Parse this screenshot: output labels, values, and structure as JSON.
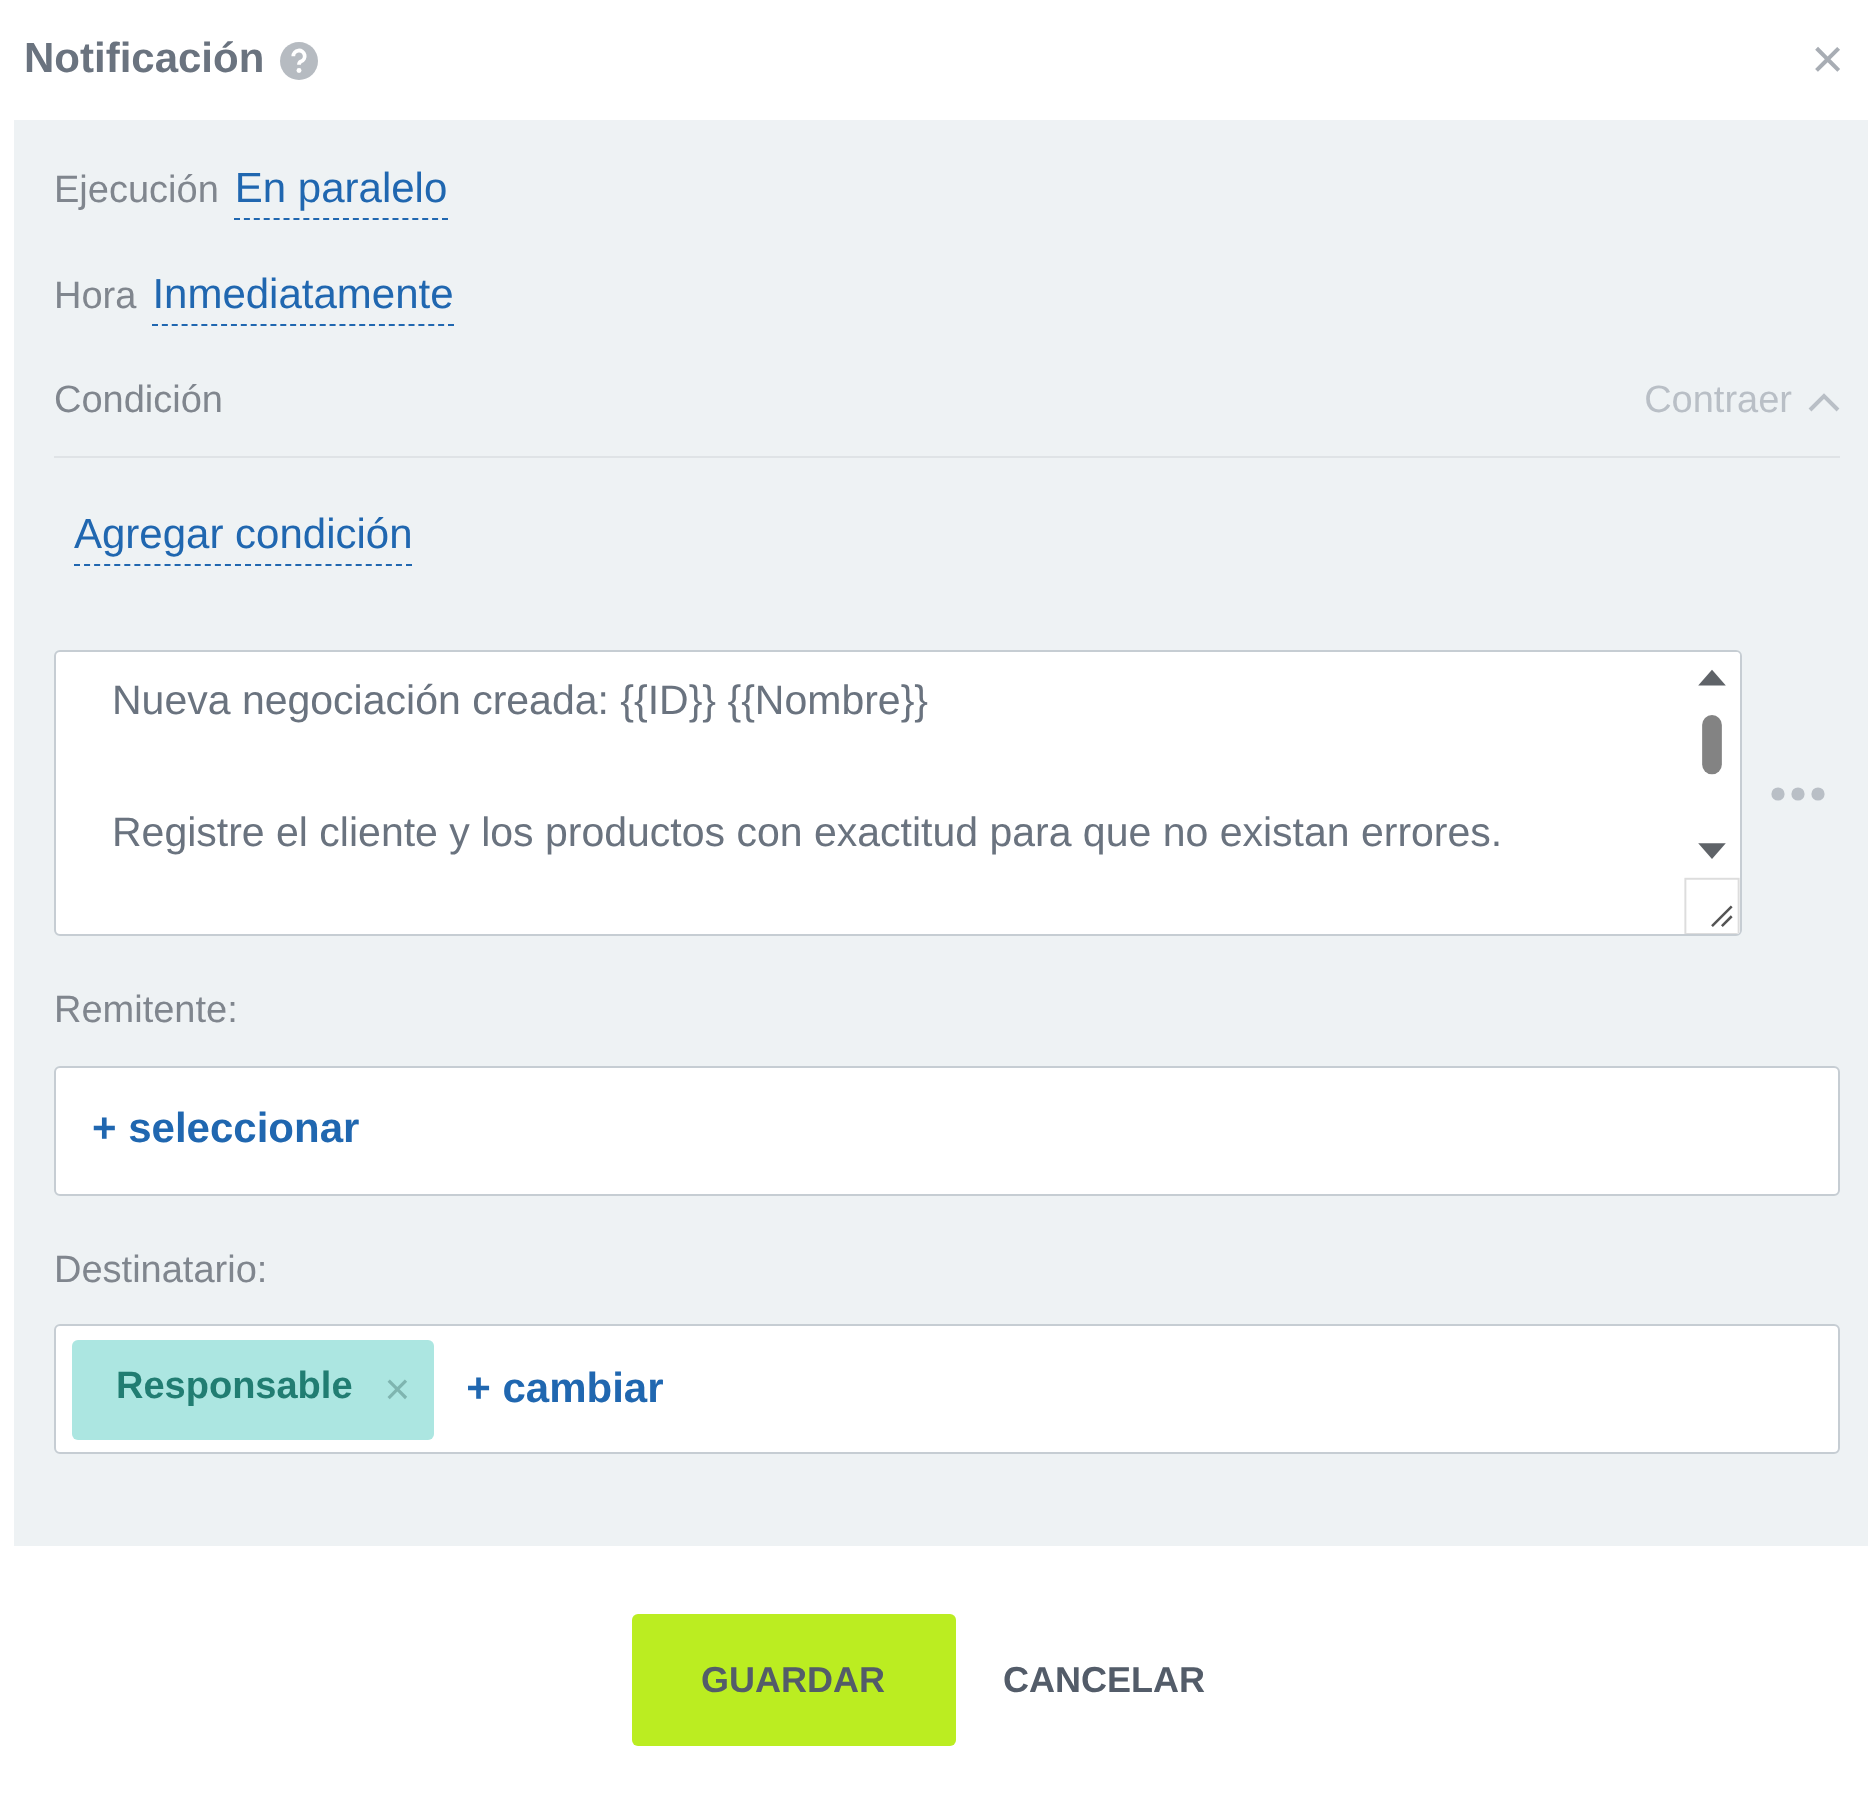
{
  "dialog": {
    "title": "Notificación",
    "close": "×"
  },
  "settings": [
    {
      "label": "Ejecución",
      "value": "En paralelo"
    },
    {
      "label": "Hora",
      "value": "Inmediatamente"
    }
  ],
  "condition": {
    "label": "Condición",
    "toggle": "Contraer",
    "expanded": true,
    "add_link": "Agregar condición"
  },
  "message": {
    "lines": [
      "Nueva negociación creada: {{ID}} {{Nombre}}",
      "Registre el cliente y los productos con exactitud para que no existan errores."
    ]
  },
  "sender": {
    "label": "Remitente:",
    "action": "+ seleccionar"
  },
  "recipient": {
    "label": "Destinatario:",
    "tags": [
      {
        "text": "Responsable",
        "remove": "×"
      }
    ],
    "action": "+ cambiar"
  },
  "buttons": [
    {
      "label": "GUARDAR",
      "kind": "primary"
    },
    {
      "label": "CANCELAR",
      "kind": "link"
    }
  ]
}
